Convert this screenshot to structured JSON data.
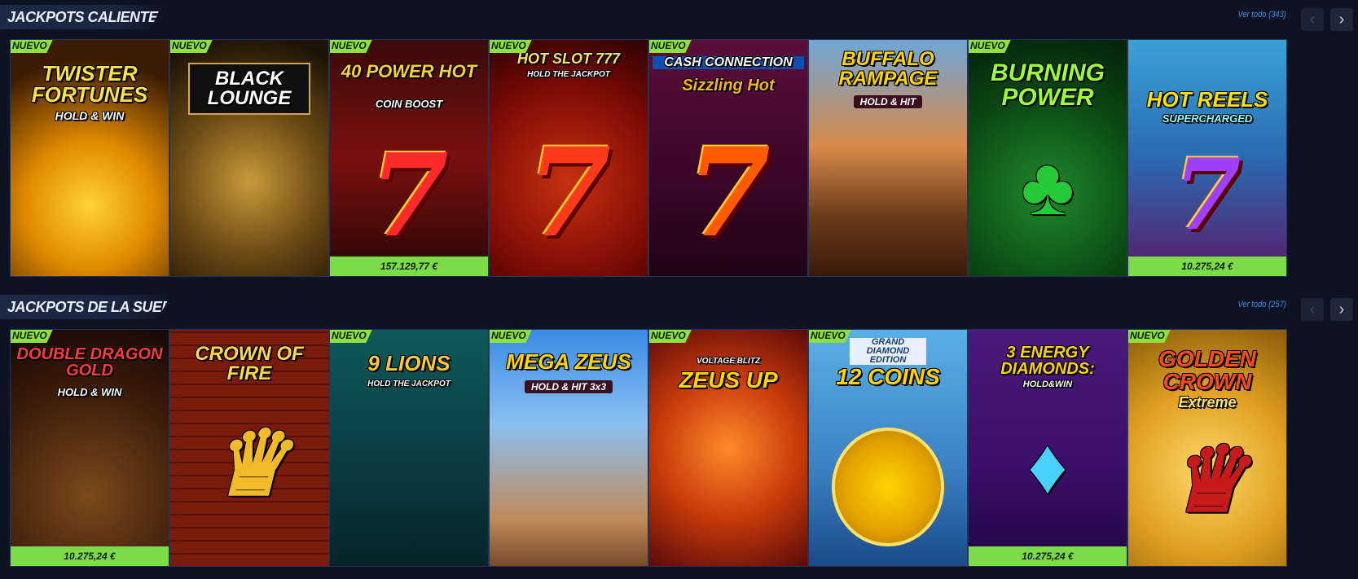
{
  "sections": [
    {
      "title": "JACKPOTS CALIENTES",
      "view_all": "Ver todo (343)",
      "games": [
        {
          "title": "TWISTER FORTUNES",
          "subtitle": "HOLD & WIN",
          "badge": "NUEVO",
          "jackpot": null
        },
        {
          "title": "BLACK LOUNGE",
          "subtitle": "",
          "badge": "NUEVO",
          "jackpot": null
        },
        {
          "title": "40 POWER HOT",
          "subtitle": "COIN BOOST",
          "badge": "NUEVO",
          "jackpot": "157.129,77 €"
        },
        {
          "title": "HOT SLOT 777",
          "subtitle": "HOLD THE JACKPOT",
          "badge": "NUEVO",
          "jackpot": null
        },
        {
          "title": "CASH CONNECTION",
          "subtitle": "Sizzling Hot",
          "badge": "NUEVO",
          "jackpot": null
        },
        {
          "title": "BUFFALO RAMPAGE",
          "subtitle": "HOLD & HIT",
          "badge": null,
          "jackpot": null
        },
        {
          "title": "BURNING POWER",
          "subtitle": "",
          "badge": "NUEVO",
          "jackpot": null
        },
        {
          "title": "HOT REELS",
          "subtitle": "SUPERCHARGED",
          "badge": null,
          "jackpot": "10.275,24 €"
        }
      ]
    },
    {
      "title": "JACKPOTS DE LA SUERTE",
      "view_all": "Ver todo (257)",
      "games": [
        {
          "title": "DOUBLE DRAGON GOLD",
          "subtitle": "HOLD & WIN",
          "badge": "NUEVO",
          "jackpot": "10.275,24 €"
        },
        {
          "title": "CROWN OF FIRE",
          "subtitle": "",
          "badge": null,
          "jackpot": null
        },
        {
          "title": "9 LIONS",
          "subtitle": "HOLD THE JACKPOT",
          "badge": "NUEVO",
          "jackpot": null
        },
        {
          "title": "MEGA ZEUS",
          "subtitle": "HOLD & HIT 3x3",
          "badge": "NUEVO",
          "jackpot": null
        },
        {
          "title": "ZEUS UP",
          "subtitle": "VOLTAGE BLITZ",
          "badge": "NUEVO",
          "jackpot": null
        },
        {
          "title": "12 COINS",
          "subtitle": "GRAND DIAMOND EDITION",
          "badge": "NUEVO",
          "jackpot": null
        },
        {
          "title": "3 ENERGY DIAMONDS:",
          "subtitle": "HOLD&WIN",
          "badge": null,
          "jackpot": "10.275,24 €"
        },
        {
          "title": "GOLDEN CROWN",
          "subtitle": "Extreme",
          "badge": "NUEVO",
          "jackpot": null
        }
      ]
    }
  ],
  "nav": {
    "prev_icon": "chevron-left-icon",
    "next_icon": "chevron-right-icon",
    "prev_glyph": "‹",
    "next_glyph": "›"
  },
  "colors": {
    "background": "#0d1322",
    "badge": "#8ee03a",
    "jackpot_bar": "#7bdc48",
    "link": "#3b8ee6"
  }
}
